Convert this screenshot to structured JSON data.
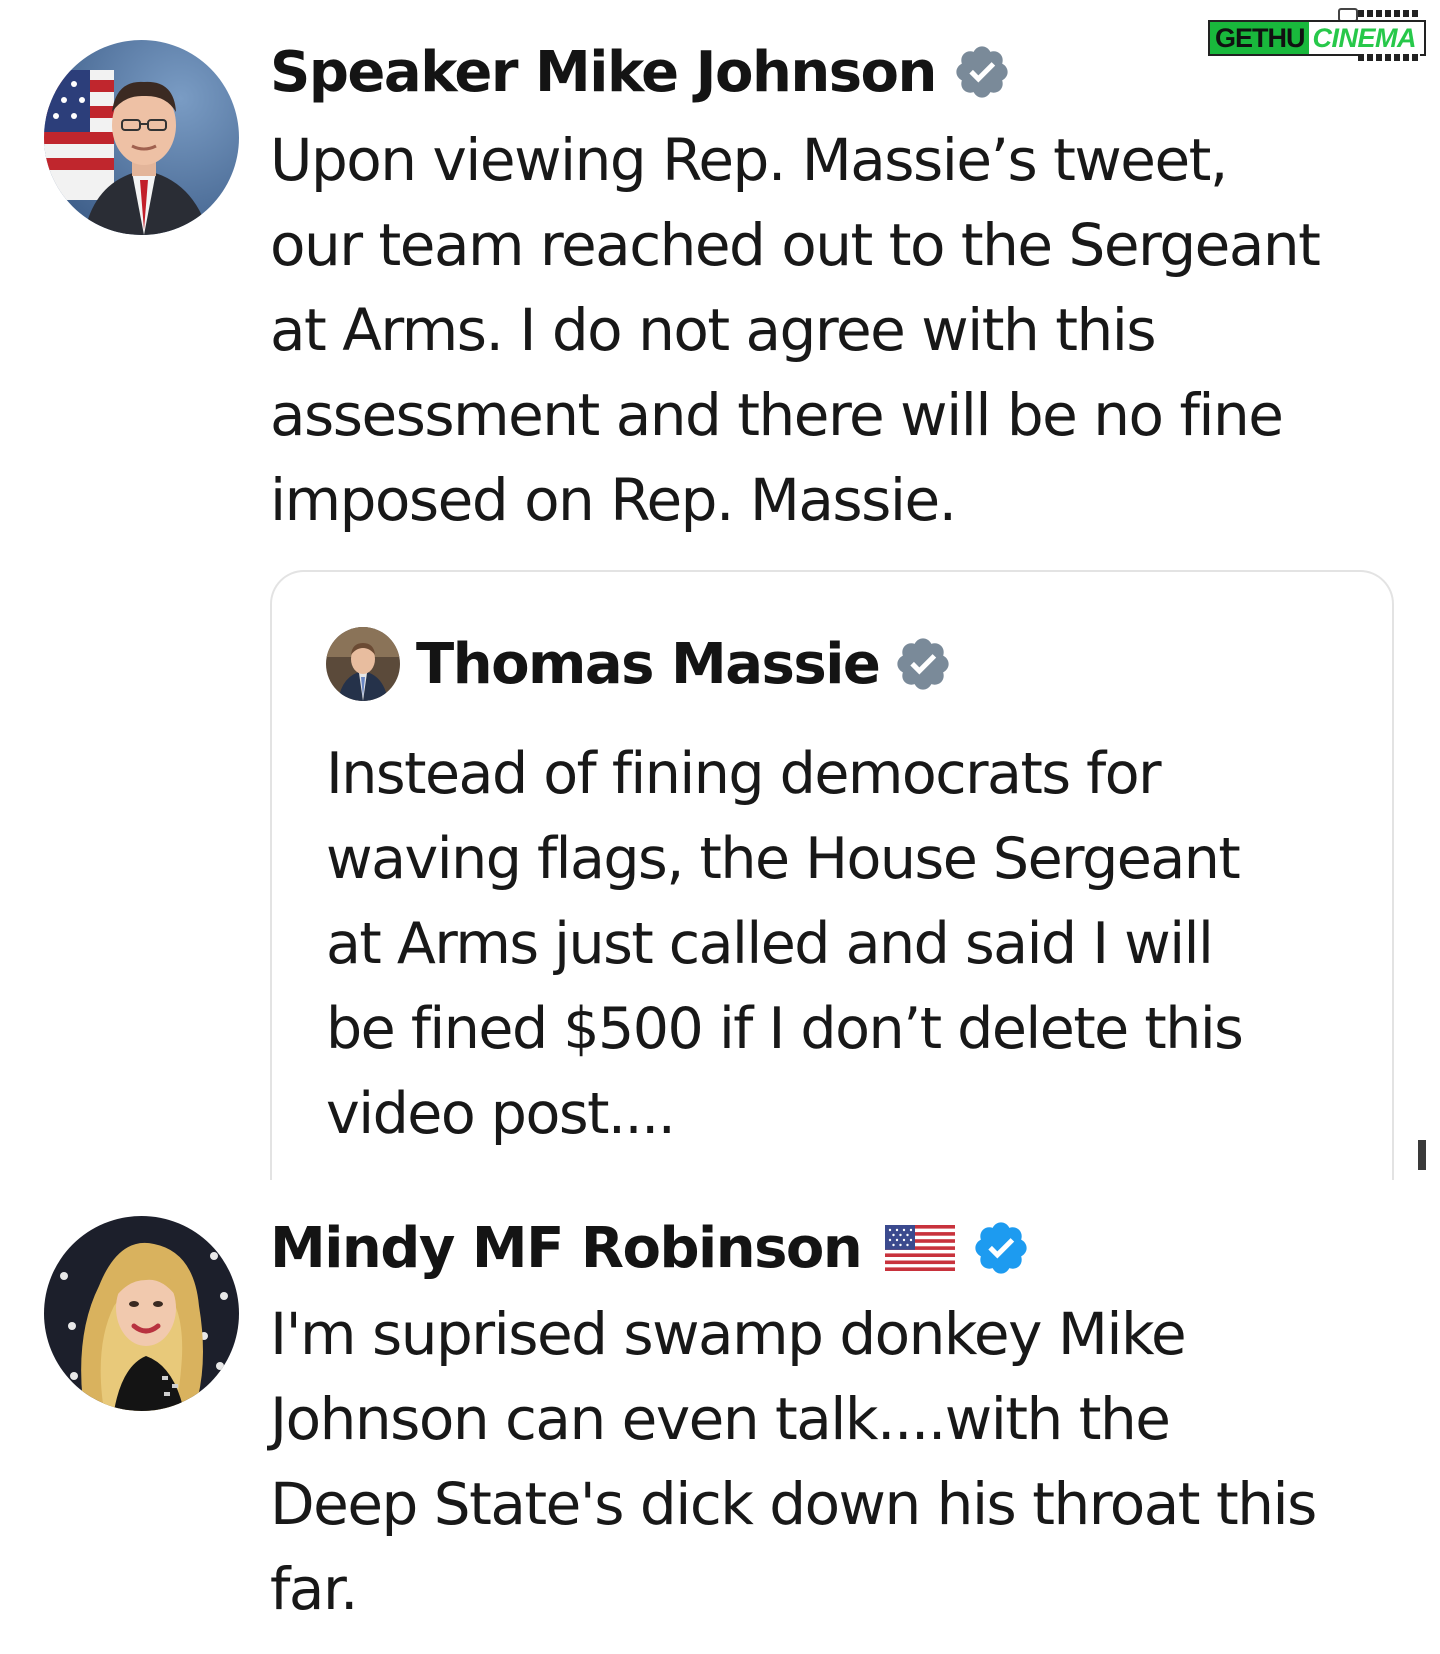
{
  "watermark": {
    "left": "GETHU",
    "right": "CINEMA"
  },
  "posts": [
    {
      "display_name": "Speaker Mike Johnson",
      "verified_color": "#7a8a99",
      "text": "Upon viewing Rep. Massie’s tweet,\nour team reached out to the Sergeant\nat Arms. I do not agree with this\nassessment and there will be no fine\nimposed on Rep. Massie.",
      "quote": {
        "display_name": "Thomas Massie",
        "verified_color": "#7a8a99",
        "text": "Instead of fining democrats for\nwaving flags, the House Sergeant\nat Arms just called and said I will\nbe fined $500 if I don’t delete this\nvideo post...."
      }
    },
    {
      "display_name": "Mindy MF Robinson",
      "name_emoji": "us-flag-icon",
      "verified_color": "#1d9bf0",
      "text": "I'm suprised swamp donkey Mike\nJohnson can even talk....with the\nDeep State's dick down his throat this\nfar."
    }
  ]
}
